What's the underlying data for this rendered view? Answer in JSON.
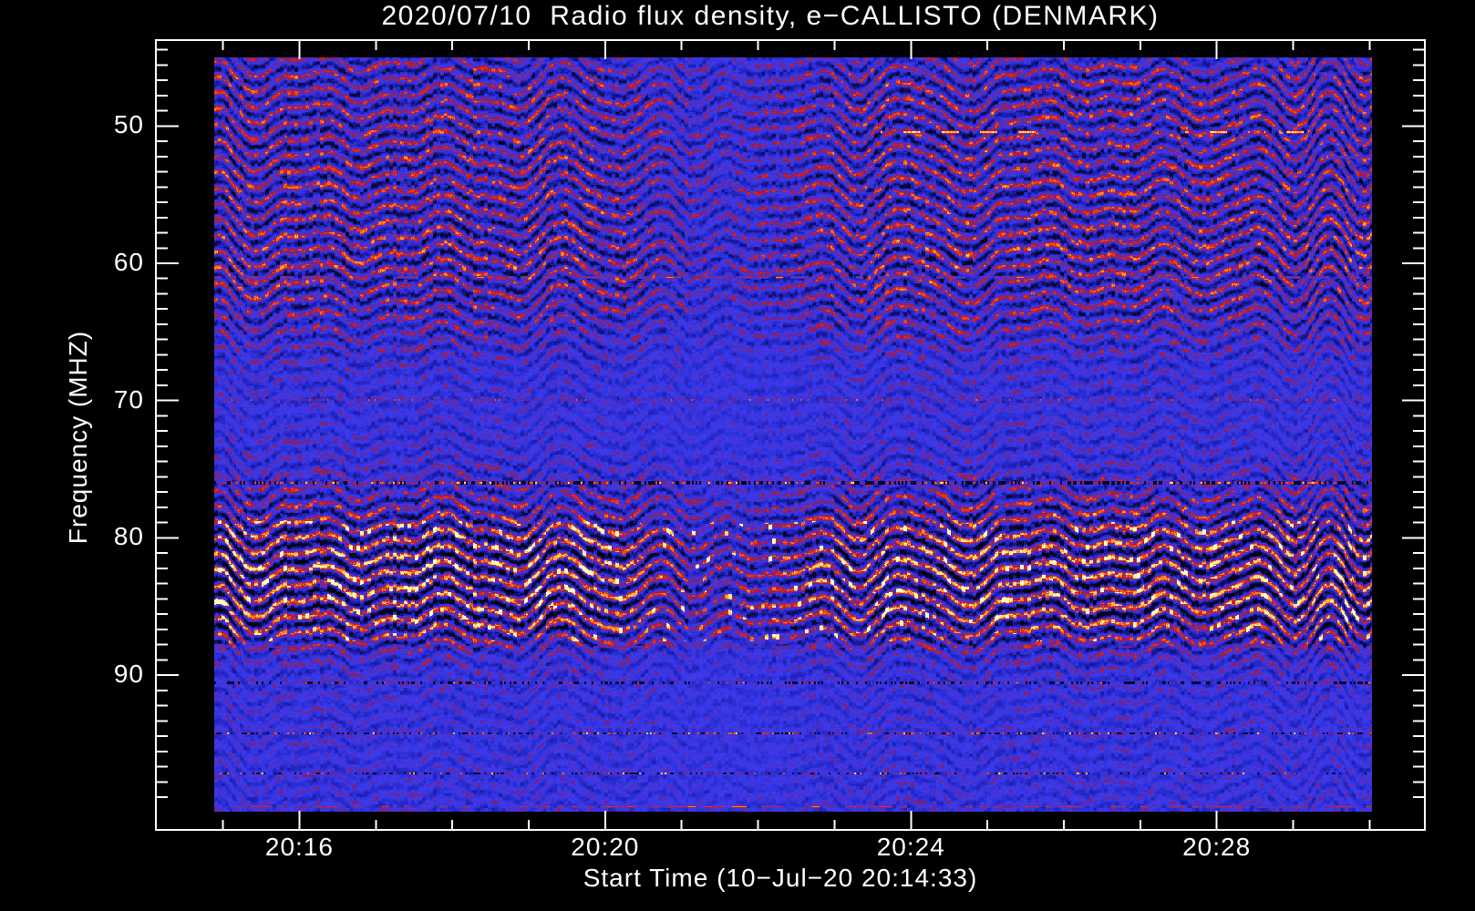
{
  "page": {
    "background": "#000000",
    "text_color": "#ffffff"
  },
  "title": "2020/07/10  Radio flux density, e−CALLISTO (DENMARK)",
  "axes": {
    "x": {
      "label": "Start Time (10−Jul−20 20:14:33)",
      "tick_labels": [
        "20:16",
        "20:20",
        "20:24",
        "20:28"
      ]
    },
    "y": {
      "label": "Frequency (MHZ)",
      "tick_labels": [
        "50",
        "60",
        "70",
        "80",
        "90"
      ]
    }
  },
  "chart_data": {
    "type": "heatmap",
    "title": "2020/07/10  Radio flux density, e−CALLISTO (DENMARK)",
    "xlabel": "Start Time (10−Jul−20 20:14:33)",
    "ylabel": "Frequency (MHZ)",
    "x_tick_labels": [
      "20:16",
      "20:20",
      "20:24",
      "20:28"
    ],
    "x_minor_tick_minutes": 1,
    "y_tick_labels": [
      50,
      60,
      70,
      80,
      90
    ],
    "freq_min": 45,
    "freq_max": 100,
    "freq_increases_downward": true,
    "x_range_estimate": [
      "20:14:53",
      "20:30:00"
    ],
    "seed": 77,
    "background_level": 0.47,
    "stripe_spacing_mhz": 1.16,
    "envelope_points": [
      [
        45,
        0.62
      ],
      [
        46,
        0.8
      ],
      [
        48,
        0.85
      ],
      [
        56,
        0.88
      ],
      [
        60,
        0.95
      ],
      [
        63,
        0.8
      ],
      [
        66,
        0.55
      ],
      [
        68,
        0.38
      ],
      [
        71,
        0.34
      ],
      [
        74,
        0.42
      ],
      [
        76,
        0.6
      ],
      [
        78,
        0.9
      ],
      [
        80,
        1.2
      ],
      [
        82,
        1.32
      ],
      [
        84,
        1.28
      ],
      [
        86,
        1.25
      ],
      [
        87.5,
        0.9
      ],
      [
        88.5,
        0.55
      ],
      [
        90,
        0.4
      ],
      [
        92,
        0.34
      ],
      [
        95,
        0.32
      ],
      [
        98,
        0.33
      ],
      [
        100,
        0.36
      ]
    ],
    "lull": {
      "center": 0.44,
      "width": 0.055,
      "depth": 0.4
    },
    "hot_band": {
      "fmin": 78.8,
      "fmax": 87.6,
      "prob": 0.11,
      "boost": 0.3
    },
    "rfi_lines": [
      {
        "f": 50.45,
        "kind": "dash",
        "thickness": 4,
        "segments": [
          [
            0.575,
            0.727
          ],
          [
            0.838,
            0.958
          ]
        ],
        "on": 19,
        "off": 23,
        "vmin": 0.86,
        "vmax": 1.0
      },
      {
        "f": 52.25,
        "kind": "dash",
        "thickness": 3,
        "segments": [
          [
            0.962,
            0.999
          ]
        ],
        "on": 400,
        "off": 0,
        "vmin": 0.62,
        "vmax": 0.72
      },
      {
        "f": 61.0,
        "kind": "runs",
        "thickness": 3,
        "density": 0.5,
        "vmin": 0.64,
        "vmax": 0.8,
        "hot": 0.1
      },
      {
        "f": 70.0,
        "kind": "dots",
        "thickness": 2,
        "density": 0.55,
        "vmin": 0.6,
        "vmax": 0.72,
        "hot": 0.06
      },
      {
        "f": 76.0,
        "kind": "speckle",
        "thickness": 4,
        "dark": 0.34,
        "red": 0.3,
        "orange": 0.1,
        "yellow": 0.05
      },
      {
        "f": 88.0,
        "kind": "runs",
        "thickness": 2,
        "density": 0.32,
        "vmin": 0.58,
        "vmax": 0.7,
        "hot": 0.03
      },
      {
        "f": 90.6,
        "kind": "speckle",
        "thickness": 3,
        "dark": 0.3,
        "red": 0.18,
        "orange": 0.04,
        "yellow": 0.01
      },
      {
        "f": 94.3,
        "kind": "speckle",
        "thickness": 2,
        "dark": 0.25,
        "red": 0.16,
        "orange": 0.07,
        "yellow": 0.04
      },
      {
        "f": 97.2,
        "kind": "speckle",
        "thickness": 2,
        "dark": 0.22,
        "red": 0.12,
        "orange": 0.04,
        "yellow": 0.02
      },
      {
        "f": 99.6,
        "kind": "runs",
        "thickness": 3,
        "density": 0.4,
        "vmin": 0.68,
        "vmax": 0.82,
        "hot": 0.05
      }
    ],
    "colormap_stops": [
      [
        0.0,
        "#000010"
      ],
      [
        0.12,
        "#08082e"
      ],
      [
        0.22,
        "#14148c"
      ],
      [
        0.32,
        "#2424c4"
      ],
      [
        0.45,
        "#3434e0"
      ],
      [
        0.55,
        "#3c3cee"
      ],
      [
        0.62,
        "#5a28b4"
      ],
      [
        0.68,
        "#8c1e5a"
      ],
      [
        0.74,
        "#c81e28"
      ],
      [
        0.8,
        "#e63214"
      ],
      [
        0.86,
        "#ff7a14"
      ],
      [
        0.93,
        "#ffc850"
      ],
      [
        1.0,
        "#ffffc0"
      ]
    ],
    "legend": "none",
    "grid": false
  }
}
